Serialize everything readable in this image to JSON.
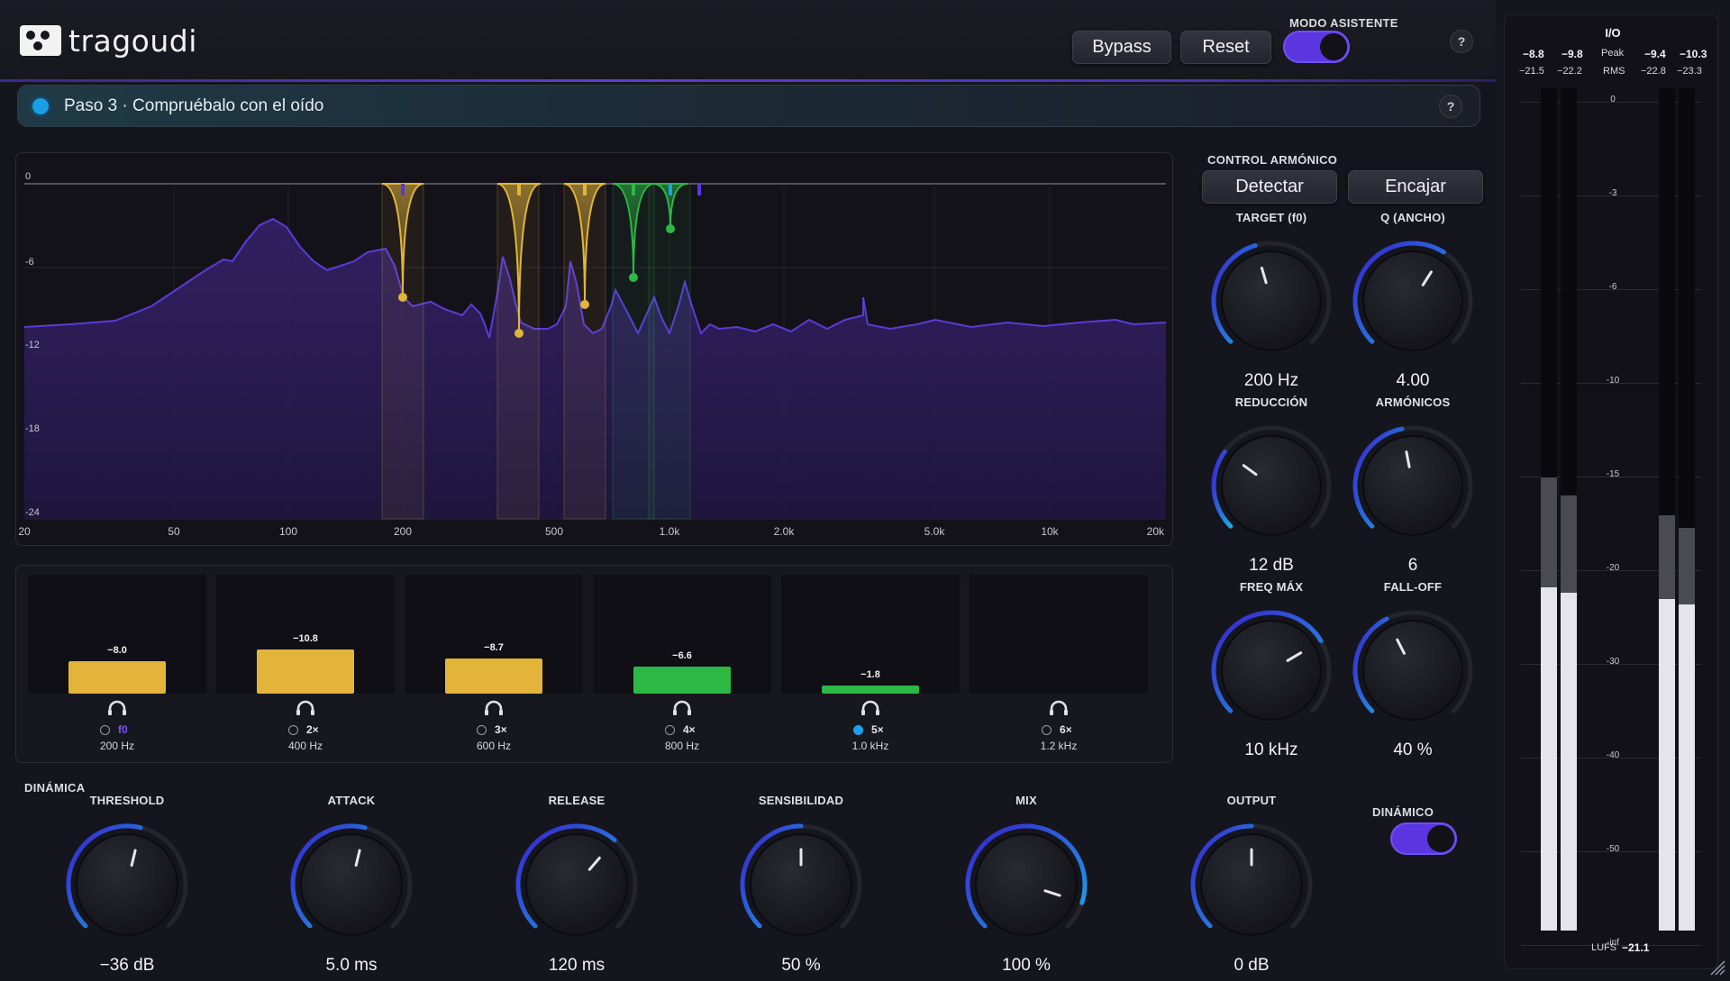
{
  "app": {
    "logo_text": "tragoudi",
    "bypass_label": "Bypass",
    "reset_label": "Reset",
    "assistant_mode_label": "MODO ASISTENTE",
    "assistant_mode_on": true,
    "help_label": "?"
  },
  "step": {
    "text": "Paso 3 · Compruébalo con el oído",
    "help_label": "?"
  },
  "spectrum": {
    "y_ticks": [
      "0",
      "-6",
      "-12",
      "-18",
      "-24"
    ],
    "x_ticks": [
      "20",
      "50",
      "100",
      "200",
      "500",
      "1.0k",
      "2.0k",
      "5.0k",
      "10k",
      "20k"
    ]
  },
  "bands": [
    {
      "value": "−8.0",
      "level_db": -8.0,
      "label": "f0",
      "freq": "200 Hz",
      "color": "#e2b53a",
      "selected": false
    },
    {
      "value": "−10.8",
      "level_db": -10.8,
      "label": "2×",
      "freq": "400 Hz",
      "color": "#e2b53a",
      "selected": false
    },
    {
      "value": "−8.7",
      "level_db": -8.7,
      "label": "3×",
      "freq": "600 Hz",
      "color": "#e2b53a",
      "selected": false
    },
    {
      "value": "−6.6",
      "level_db": -6.6,
      "label": "4×",
      "freq": "800 Hz",
      "color": "#2db845",
      "selected": false
    },
    {
      "value": "−1.8",
      "level_db": -1.8,
      "label": "5×",
      "freq": "1.0 kHz",
      "color": "#2db845",
      "selected": true
    },
    {
      "value": "",
      "level_db": 0,
      "label": "6×",
      "freq": "1.2 kHz",
      "color": "#2db845",
      "selected": false
    }
  ],
  "harmonic_control": {
    "title": "CONTROL ARMÓNICO",
    "detect_label": "Detectar",
    "fit_label": "Encajar",
    "knobs": [
      {
        "title": "TARGET (f0)",
        "value": "200 Hz",
        "fraction": 0.44
      },
      {
        "title": "Q (ANCHO)",
        "value": "4.00",
        "fraction": 0.62
      },
      {
        "title": "REDUCCIÓN",
        "value": "12 dB",
        "fraction": 0.3
      },
      {
        "title": "ARMÓNICOS",
        "value": "6",
        "fraction": 0.46
      },
      {
        "title": "FREQ MÁX",
        "value": "10 kHz",
        "fraction": 0.72
      },
      {
        "title": "FALL-OFF",
        "value": "40 %",
        "fraction": 0.4
      }
    ]
  },
  "dynamics": {
    "title": "DINÁMICA",
    "knobs": [
      {
        "title": "THRESHOLD",
        "value": "−36 dB",
        "fraction": 0.55
      },
      {
        "title": "ATTACK",
        "value": "5.0 ms",
        "fraction": 0.55
      },
      {
        "title": "RELEASE",
        "value": "120 ms",
        "fraction": 0.65
      },
      {
        "title": "SENSIBILIDAD",
        "value": "50 %",
        "fraction": 0.5
      },
      {
        "title": "MIX",
        "value": "100 %",
        "fraction": 0.9
      },
      {
        "title": "OUTPUT",
        "value": "0 dB",
        "fraction": 0.5
      }
    ],
    "dynamic_label": "DINÁMICO",
    "dynamic_on": true
  },
  "meter": {
    "title": "I/O",
    "in_peak_l": "−8.8",
    "in_peak_r": "−9.8",
    "in_rms_l": "−21.5",
    "in_rms_r": "−22.2",
    "peak_label": "Peak",
    "rms_label": "RMS",
    "out_peak_l": "−9.4",
    "out_peak_r": "−10.3",
    "out_rms_l": "−22.8",
    "out_rms_r": "−23.3",
    "scale": [
      "0",
      "-3",
      "-6",
      "-10",
      "-15",
      "-20",
      "-30",
      "-40",
      "-50",
      "-inf"
    ],
    "lufs_label": "LUFS",
    "lufs_value": "−21.1"
  }
}
